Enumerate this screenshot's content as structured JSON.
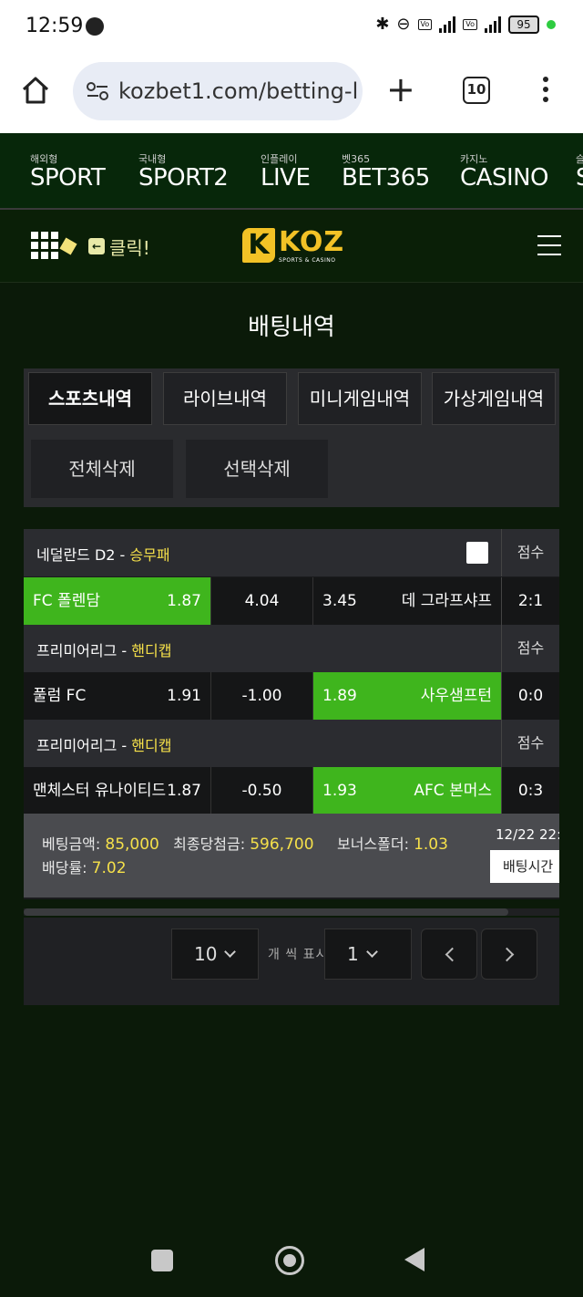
{
  "status_bar": {
    "time": "12:59",
    "battery": "95"
  },
  "browser": {
    "url": "kozbet1.com/betting-l",
    "tab_count": "10",
    "plus": "+"
  },
  "nav": [
    {
      "small": "해외형",
      "label": "SPORT"
    },
    {
      "small": "국내형",
      "label": "SPORT2"
    },
    {
      "small": "인플레이",
      "label": "LIVE"
    },
    {
      "small": "벳365",
      "label": "BET365"
    },
    {
      "small": "카지노",
      "label": "CASINO"
    },
    {
      "small": "슬",
      "label": "S"
    }
  ],
  "header": {
    "click_label": "클릭!",
    "click_icon": "←",
    "logo_mark": "K",
    "logo_word": "KOZ",
    "logo_sub": "SPORTS & CASINO"
  },
  "page_title": "배팅내역",
  "tabs": [
    {
      "label": "스포츠내역",
      "active": true
    },
    {
      "label": "라이브내역"
    },
    {
      "label": "미니게임내역"
    },
    {
      "label": "가상게임내역"
    }
  ],
  "actions": {
    "delete_all": "전체삭제",
    "delete_selected": "선택삭제"
  },
  "bets": [
    {
      "league": "네덜란드 D2",
      "type": "승무패",
      "score_label": "점수",
      "home": "FC 폴렌담",
      "home_odd": "1.87",
      "draw": "4.04",
      "away_odd": "3.45",
      "away": "데 그라프샤프",
      "score": "2:1",
      "selected": "home"
    },
    {
      "league": "프리미어리그",
      "type": "핸디캡",
      "score_label": "점수",
      "home": "풀럼 FC",
      "home_odd": "1.91",
      "draw": "-1.00",
      "away_odd": "1.89",
      "away": "사우샘프턴",
      "score": "0:0",
      "selected": "away"
    },
    {
      "league": "프리미어리그",
      "type": "핸디캡",
      "score_label": "점수",
      "home": "맨체스터 유나이티드",
      "home_odd": "1.87",
      "draw": "-0.50",
      "away_odd": "1.93",
      "away": "AFC 본머스",
      "score": "0:3",
      "selected": "away"
    }
  ],
  "summary": {
    "bet_amount_label": "베팅금액:",
    "bet_amount": "85,000",
    "final_payout_label": "최종당첨금:",
    "final_payout": "596,700",
    "bonus_label": "보너스폴더:",
    "bonus": "1.03",
    "odds_label": "배당률:",
    "odds": "7.02",
    "date": "12/22 22:",
    "bet_time_button": "배팅시간"
  },
  "pagination": {
    "per_page": "10",
    "per_page_label": "개 씩 표시",
    "page": "1"
  },
  "colors": {
    "highlight": "#3fb51d",
    "accent": "#f5e04a",
    "logo": "#f2c226"
  }
}
